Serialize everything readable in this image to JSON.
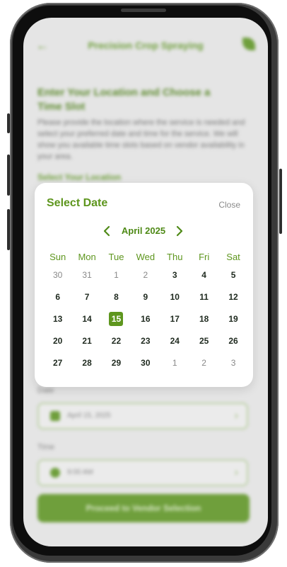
{
  "app": {
    "header_title": "Precision Crop Spraying",
    "heading": "Enter Your Location and Choose a Time Slot",
    "description": "Please provide the location where the service is needed and select your preferred date and time for the service. We will show you available time slots based on vendor availability in your area.",
    "select_location_label": "Select Your Location",
    "date_label": "Date",
    "date_value": "April 15, 2025",
    "time_label": "Time",
    "time_value": "9:00 AM",
    "proceed_button": "Proceed to Vendor Selection"
  },
  "modal": {
    "title": "Select Date",
    "close_label": "Close",
    "month_label": "April 2025",
    "weekdays": [
      "Sun",
      "Mon",
      "Tue",
      "Wed",
      "Thu",
      "Fri",
      "Sat"
    ],
    "weeks": [
      [
        "30",
        "31",
        "1",
        "2",
        "3",
        "4",
        "5"
      ],
      [
        "6",
        "7",
        "8",
        "9",
        "10",
        "11",
        "12"
      ],
      [
        "13",
        "14",
        "15",
        "16",
        "17",
        "18",
        "19"
      ],
      [
        "20",
        "21",
        "22",
        "23",
        "24",
        "25",
        "26"
      ],
      [
        "27",
        "28",
        "29",
        "30",
        "1",
        "2",
        "3"
      ]
    ],
    "selected_day": "15",
    "accent_color": "#5e961e"
  }
}
